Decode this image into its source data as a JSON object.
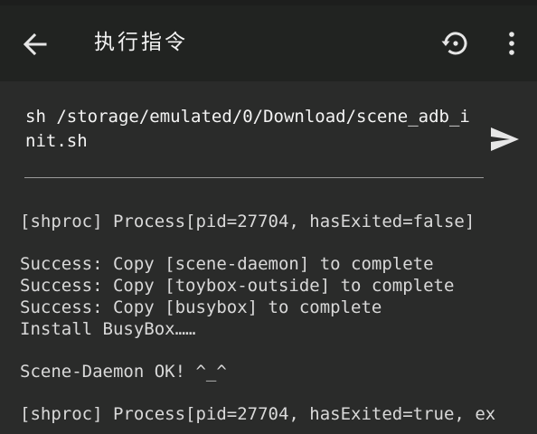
{
  "appbar": {
    "title": "执行指令",
    "back_icon": "arrow-back-icon",
    "history_icon": "history-icon",
    "menu_icon": "more-vert-icon"
  },
  "command": {
    "value": "sh /storage/emulated/0/Download/scene_adb_init.sh",
    "send_icon": "send-icon"
  },
  "output": {
    "lines": [
      "[shproc] Process[pid=27704, hasExited=false]",
      "",
      "Success: Copy [scene-daemon] to complete",
      "Success: Copy [toybox-outside] to complete",
      "Success: Copy [busybox] to complete",
      "Install BusyBox……",
      "",
      "Scene-Daemon OK! ^_^",
      "",
      "[shproc] Process[pid=27704, hasExited=true, ex"
    ]
  },
  "colors": {
    "background": "#2a2b2a",
    "appbar": "#212321",
    "text": "#f2f2f2",
    "output_text": "#d9d9d9",
    "icon": "#e6e6e6"
  }
}
